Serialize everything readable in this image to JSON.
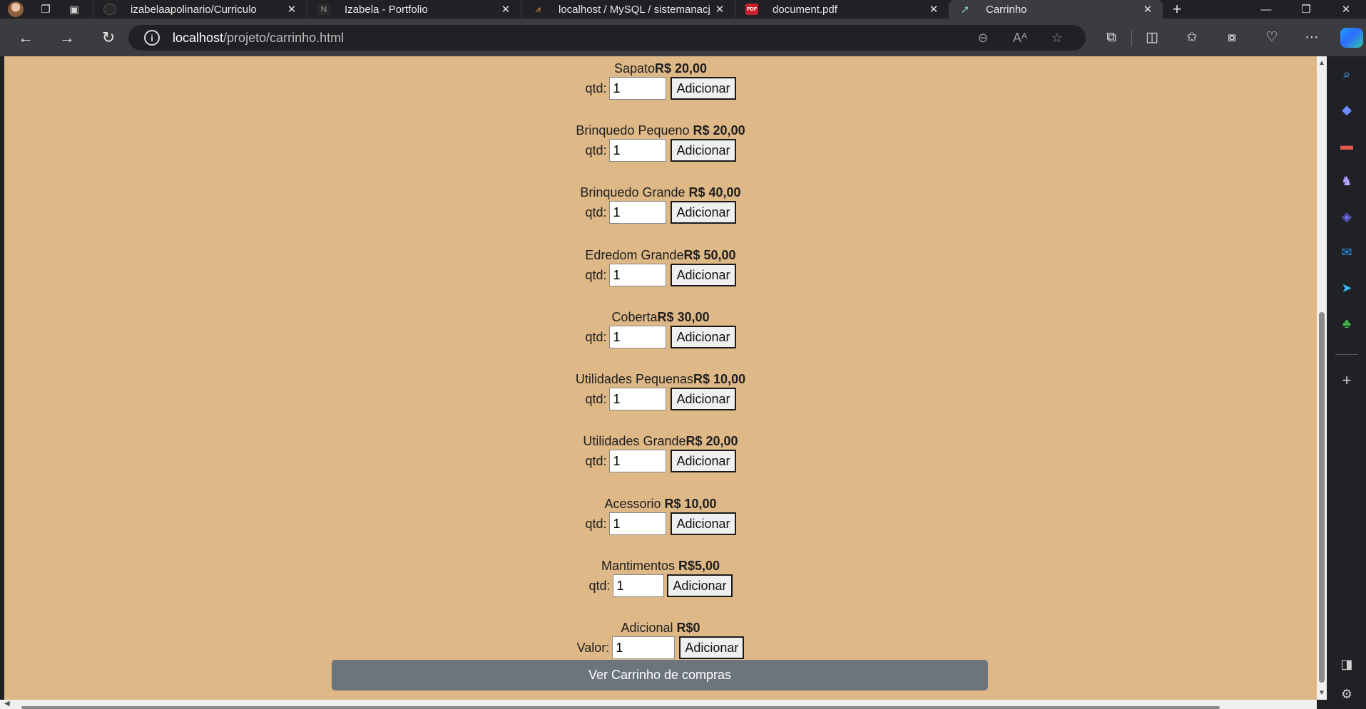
{
  "browser": {
    "tabs": [
      {
        "title": "izabelaapolinario/Curriculo",
        "active": false,
        "icon": "github-icon"
      },
      {
        "title": "Izabela - Portfolio",
        "active": false,
        "icon": "portfolio-icon"
      },
      {
        "title": "localhost / MySQL / sistemanacj",
        "active": false,
        "icon": "phpmyadmin-icon"
      },
      {
        "title": "document.pdf",
        "active": false,
        "icon": "pdf-icon"
      },
      {
        "title": "Carrinho",
        "active": true,
        "icon": "cart-favicon-icon"
      }
    ],
    "url_host": "localhost",
    "url_path": "/projeto/carrinho.html",
    "pdf_badge": "PDF"
  },
  "products": [
    {
      "name": "Sapato",
      "price": "R$ 20,00",
      "qty_label": "qtd:",
      "qty": "1",
      "button": "Adicionar"
    },
    {
      "name": "Brinquedo Pequeno ",
      "price": "R$ 20,00",
      "qty_label": "qtd:",
      "qty": "1",
      "button": "Adicionar"
    },
    {
      "name": "Brinquedo Grande ",
      "price": "R$ 40,00",
      "qty_label": "qtd:",
      "qty": "1",
      "button": "Adicionar"
    },
    {
      "name": "Edredom Grande",
      "price": "R$ 50,00",
      "qty_label": "qtd:",
      "qty": "1",
      "button": "Adicionar"
    },
    {
      "name": "Coberta",
      "price": "R$ 30,00",
      "qty_label": "qtd:",
      "qty": "1",
      "button": "Adicionar"
    },
    {
      "name": "Utilidades Pequenas",
      "price": "R$ 10,00",
      "qty_label": "qtd:",
      "qty": "1",
      "button": "Adicionar"
    },
    {
      "name": "Utilidades Grande",
      "price": "R$ 20,00",
      "qty_label": "qtd:",
      "qty": "1",
      "button": "Adicionar"
    },
    {
      "name": "Acessorio ",
      "price": "R$ 10,00",
      "qty_label": "qtd:",
      "qty": "1",
      "button": "Adicionar"
    },
    {
      "name": "Mantimentos ",
      "price": "R$5,00",
      "qty_label": "qtd:",
      "qty": "1",
      "button": "Adicionar"
    },
    {
      "name": "Adicional ",
      "price": "R$0",
      "qty_label": "Valor:",
      "qty": "1",
      "button": "Adicionar"
    }
  ],
  "cart_button": "Ver Carrinho de compras",
  "colors": {
    "page_background": "#deb887",
    "cart_button": "#6c757d",
    "browser_chrome": "#3b3c3f"
  }
}
